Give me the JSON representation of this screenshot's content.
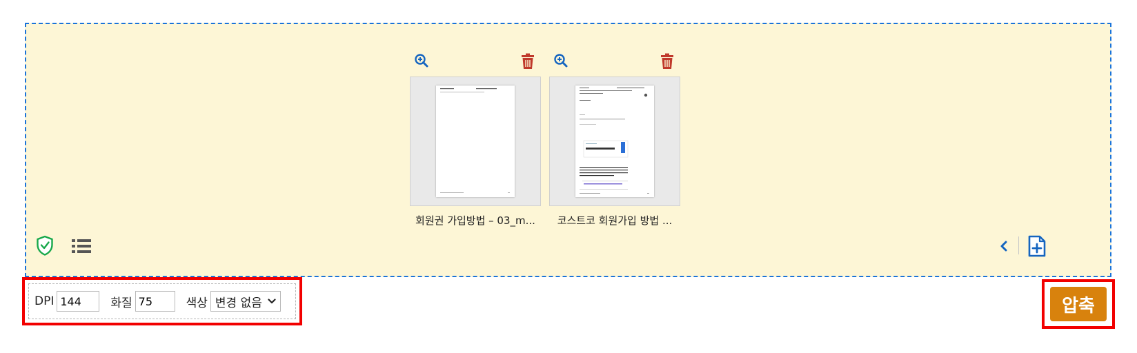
{
  "files": [
    {
      "name": "회원권 가입방법 – 03_m..."
    },
    {
      "name": "코스트코 회원가입 방법 ..."
    }
  ],
  "options": {
    "dpi_label": "DPI",
    "dpi_value": "144",
    "quality_label": "화질",
    "quality_value": "75",
    "color_label": "색상",
    "color_value": "변경 없음"
  },
  "compress_label": "압축",
  "colors": {
    "accent": "#d8820d",
    "dropzone_bg": "#fdf6d6",
    "border": "#1a73d9",
    "highlight": "#f20000"
  }
}
